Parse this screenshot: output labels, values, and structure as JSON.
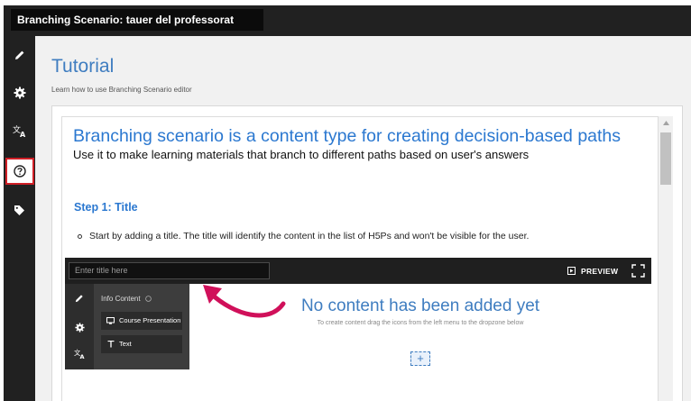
{
  "header": {
    "title": "Branching Scenario: tauer del professorat"
  },
  "sidebar": {
    "items": [
      {
        "icon": "pencil-icon"
      },
      {
        "icon": "gear-icon"
      },
      {
        "icon": "translate-icon"
      },
      {
        "icon": "help-circle-icon",
        "active": true
      },
      {
        "icon": "tag-icon"
      }
    ]
  },
  "page": {
    "title": "Tutorial",
    "subtitle": "Learn how to use Branching Scenario editor"
  },
  "tutorial": {
    "heading": "Branching scenario is a content type for creating decision-based paths",
    "lead": "Use it to make learning materials that branch to different paths based on user's answers",
    "step_title": "Step 1: Title",
    "bullet": "Start by adding a title. The title will identify the content in the list of H5Ps and won't be visible for the user."
  },
  "embedded_editor": {
    "title_placeholder": "Enter title here",
    "preview_label": "PREVIEW",
    "menu_header": "Info Content",
    "menu_items": [
      "Course Presentation",
      "Text"
    ],
    "empty_title": "No content has been added yet",
    "empty_subtitle": "To create content drag the icons from the left menu to the dropzone below",
    "drop_symbol": "+"
  },
  "colors": {
    "accent": "#2b78d0",
    "highlight_border": "#d01f26",
    "arrow": "#d0105a",
    "chrome": "#212121"
  }
}
